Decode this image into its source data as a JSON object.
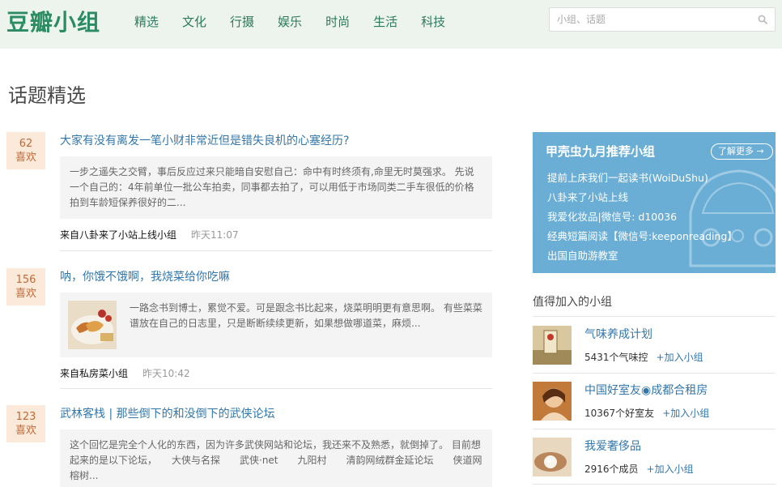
{
  "header": {
    "logo": "豆瓣小组",
    "nav": [
      "精选",
      "文化",
      "行摄",
      "娱乐",
      "时尚",
      "生活",
      "科技"
    ],
    "search_placeholder": "小组、话题"
  },
  "page_title": "话题精选",
  "topics": [
    {
      "likes": "62",
      "likes_label": "喜欢",
      "title": "大家有没有离发一笔小财非常近但是错失良机的心塞经历?",
      "excerpt": "一步之遥失之交臂，事后反应过来只能暗自安慰自己：命中有时终须有,命里无时莫强求。 先说一个自己的：4年前单位一批公车拍卖，同事都去拍了，可以用低于市场同类二手车很低的价格拍到车龄短保养很好的二...",
      "source": "来自八卦来了小站上线小组",
      "time": "昨天11:07"
    },
    {
      "likes": "156",
      "likes_label": "喜欢",
      "title": "呐，你饿不饿啊，我烧菜给你吃嘛",
      "excerpt": "一路念书到博士，累觉不爱。可是跟念书比起来，烧菜明明更有意思啊。 有些菜菜谱放在自己的日志里，只是断断续续更新，如果想做哪道菜，麻烦...",
      "source": "来自私房菜小组",
      "time": "昨天10:42"
    },
    {
      "likes": "123",
      "likes_label": "喜欢",
      "title": "武林客栈 | 那些倒下的和没倒下的武侠论坛",
      "excerpt": "这个回忆是完全个人化的东西，因为许多武侠网站和论坛，我还来不及熟悉，就倒掉了。 目前想起来的是以下论坛，　　大侠与名探　　武侠·net　　九阳村　　清韵网绒群金延论坛　　侠道网　　榕树...",
      "source": "",
      "time": ""
    }
  ],
  "banner": {
    "title": "甲壳虫九月推荐小组",
    "learn_more": "了解更多 →",
    "items": [
      "提前上床我们一起读书(WoiDuShu)",
      "八卦来了小站上线",
      "我爱化妆品|微信号: d10036",
      "经典短篇阅读【微信号:keeponreading】",
      "出国自助游教室"
    ]
  },
  "sidebar": {
    "heading": "值得加入的小组",
    "groups": [
      {
        "name": "气味养成计划",
        "count": "5431个气味控",
        "join": "+加入小组"
      },
      {
        "name": "中国好室友◉成都合租房",
        "count": "10367个好室友",
        "join": "+加入小组"
      },
      {
        "name": "我爱奢侈品",
        "count": "2916个成员",
        "join": "+加入小组"
      }
    ]
  },
  "colors": {
    "brand": "#2b8c62",
    "link": "#3377aa",
    "header_bg": "#edf4ed",
    "likes_bg": "#fbe9d9",
    "likes_text": "#c06a38",
    "banner_bg": "#6aaed6"
  }
}
